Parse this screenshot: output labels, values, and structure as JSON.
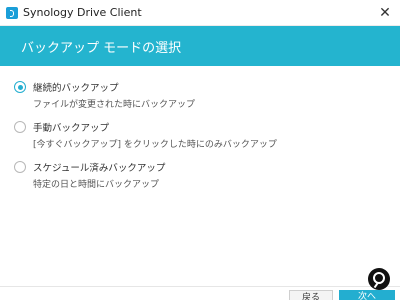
{
  "window": {
    "title": "Synology Drive Client",
    "close_glyph": "✕",
    "app_icon": "synology-drive-icon"
  },
  "header": {
    "title": "バックアップ モードの選択",
    "background_color": "#24b4cf"
  },
  "options": [
    {
      "label": "継続的バックアップ",
      "description": "ファイルが変更された時にバックアップ",
      "selected": true
    },
    {
      "label": "手動バックアップ",
      "description": "[今すぐバックアップ] をクリックした時にのみバックアップ",
      "selected": false
    },
    {
      "label": "スケジュール済みバックアップ",
      "description": "特定の日と時間にバックアップ",
      "selected": false
    }
  ],
  "footer": {
    "back_label": "戻る",
    "next_label": "次へ"
  },
  "accent_color": "#23aed0",
  "overlay_icon": "search-icon"
}
